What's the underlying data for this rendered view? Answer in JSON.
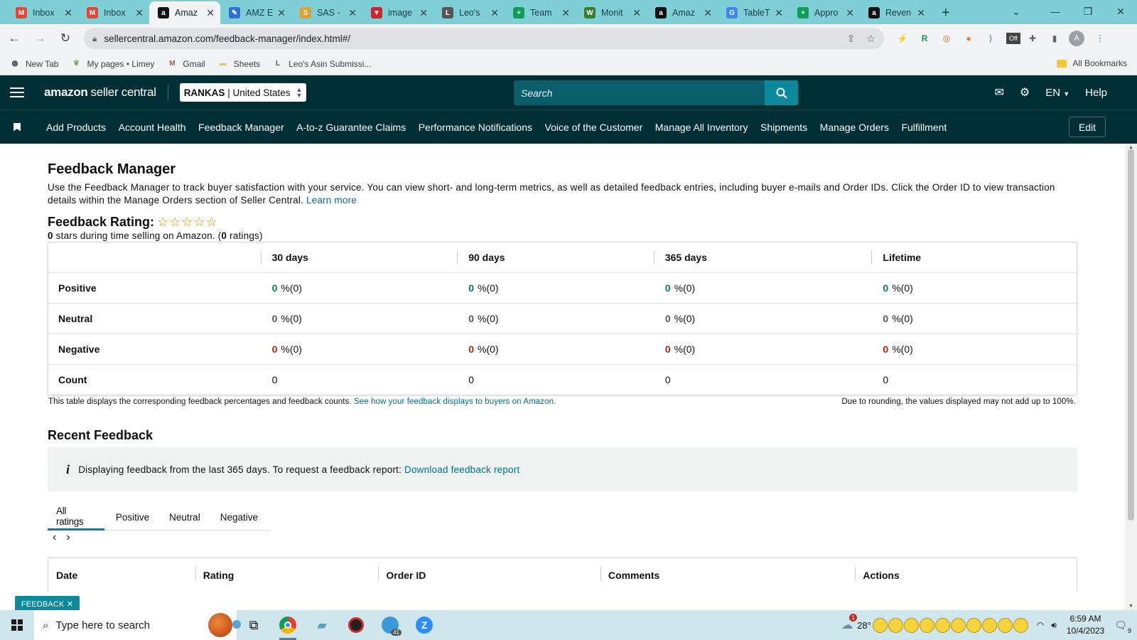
{
  "browser": {
    "tabs": [
      {
        "label": "Inbox",
        "icon": "gmail-icon",
        "color": "#ea4335",
        "glyph": "M"
      },
      {
        "label": "Inbox",
        "icon": "gmail-icon",
        "color": "#ea4335",
        "glyph": "M"
      },
      {
        "label": "Amaz",
        "icon": "amazon-icon",
        "color": "#111111",
        "glyph": "a",
        "active": true
      },
      {
        "label": "AMZ E",
        "icon": "pencil-icon",
        "color": "#2f6fd6",
        "glyph": "✎"
      },
      {
        "label": "SAS -",
        "icon": "sas-icon",
        "color": "#e0a030",
        "glyph": "S"
      },
      {
        "label": "image",
        "icon": "triangle-icon",
        "color": "#d0242b",
        "glyph": "▼"
      },
      {
        "label": "Leo's",
        "icon": "sheet-icon",
        "color": "#555555",
        "glyph": "L"
      },
      {
        "label": "Team",
        "icon": "plus-sheet-icon",
        "color": "#0f9d58",
        "glyph": "+"
      },
      {
        "label": "Monit",
        "icon": "w-icon",
        "color": "#3a7d2a",
        "glyph": "W"
      },
      {
        "label": "Amaz",
        "icon": "amazon-icon",
        "color": "#111111",
        "glyph": "a"
      },
      {
        "label": "TableT",
        "icon": "google-icon",
        "color": "#4285f4",
        "glyph": "G"
      },
      {
        "label": "Appro",
        "icon": "plus-sheet-icon",
        "color": "#0f9d58",
        "glyph": "+"
      },
      {
        "label": "Reven",
        "icon": "amazon-icon",
        "color": "#111111",
        "glyph": "a"
      }
    ],
    "url": "sellercentral.amazon.com/feedback-manager/index.html#/",
    "bookmarks": [
      {
        "label": "New Tab",
        "icon": "globe-icon"
      },
      {
        "label": "My pages • Limey",
        "icon": "leaf-icon"
      },
      {
        "label": "Gmail",
        "icon": "gmail-icon"
      },
      {
        "label": "Sheets",
        "icon": "folder-icon"
      },
      {
        "label": "Leo's Asin Submissi...",
        "icon": "sheet-icon"
      }
    ],
    "all_bookmarks": "All Bookmarks"
  },
  "header": {
    "brand": "amazon",
    "brand_suffix": "seller central",
    "store_name": "RANKAS",
    "store_region": "| United States",
    "search_placeholder": "Search",
    "language": "EN",
    "help": "Help"
  },
  "nav": {
    "items": [
      "Add Products",
      "Account Health",
      "Feedback Manager",
      "A-to-z Guarantee Claims",
      "Performance Notifications",
      "Voice of the Customer",
      "Manage All Inventory",
      "Shipments",
      "Manage Orders",
      "Fulfillment"
    ],
    "edit": "Edit"
  },
  "page": {
    "title": "Feedback Manager",
    "intro": "Use the Feedback Manager to track buyer satisfaction with your service. You can view short- and long-term metrics, as well as detailed feedback entries, including buyer e-mails and Order IDs. Click the Order ID to view transaction details within the Manage Orders section of Seller Central.",
    "learn_more": "Learn more",
    "rating_label": "Feedback Rating:",
    "stars": "☆☆☆☆☆",
    "stars_count": "0",
    "stars_text": "stars during time selling on Amazon. (",
    "ratings_count": "0",
    "ratings_text": "ratings)"
  },
  "feedback_table": {
    "columns": [
      "",
      "30 days",
      "90 days",
      "365 days",
      "Lifetime"
    ],
    "rows": [
      {
        "label": "Positive",
        "kind": "pos",
        "values": [
          [
            "0",
            "%(0)"
          ],
          [
            "0",
            "%(0)"
          ],
          [
            "0",
            "%(0)"
          ],
          [
            "0",
            "%(0)"
          ]
        ]
      },
      {
        "label": "Neutral",
        "kind": "neu",
        "values": [
          [
            "0",
            "%(0)"
          ],
          [
            "0",
            "%(0)"
          ],
          [
            "0",
            "%(0)"
          ],
          [
            "0",
            "%(0)"
          ]
        ]
      },
      {
        "label": "Negative",
        "kind": "neg",
        "values": [
          [
            "0",
            "%(0)"
          ],
          [
            "0",
            "%(0)"
          ],
          [
            "0",
            "%(0)"
          ],
          [
            "0",
            "%(0)"
          ]
        ]
      },
      {
        "label": "Count",
        "kind": "count",
        "values": [
          [
            "0",
            ""
          ],
          [
            "0",
            ""
          ],
          [
            "0",
            ""
          ],
          [
            "0",
            ""
          ]
        ]
      }
    ],
    "note": "This table displays the corresponding feedback percentages and feedback counts.",
    "note_link": "See how your feedback displays to buyers on Amazon.",
    "rounding_note": "Due to rounding, the values displayed may not add up to 100%."
  },
  "recent": {
    "title": "Recent Feedback",
    "info_text": "Displaying feedback from the last 365 days. To request a feedback report:",
    "info_link": "Download feedback report",
    "tabs": [
      "All ratings",
      "Positive",
      "Neutral",
      "Negative"
    ],
    "columns": [
      "Date",
      "Rating",
      "Order ID",
      "Comments",
      "Actions"
    ]
  },
  "feedback_pill": "FEEDBACK ✕",
  "taskbar": {
    "search_placeholder": "Type here to search",
    "weather": "28°",
    "weather_badge": "1",
    "telegram_badge": "41",
    "time": "6:59 AM",
    "date": "10/4/2023",
    "notif_count": "9"
  },
  "colors": {
    "header_bg": "#002f36",
    "accent_teal": "#0b8a9b",
    "link": "#007185",
    "positive": "#067d62",
    "negative": "#b12704",
    "tabbar": "#7ecfd6"
  }
}
